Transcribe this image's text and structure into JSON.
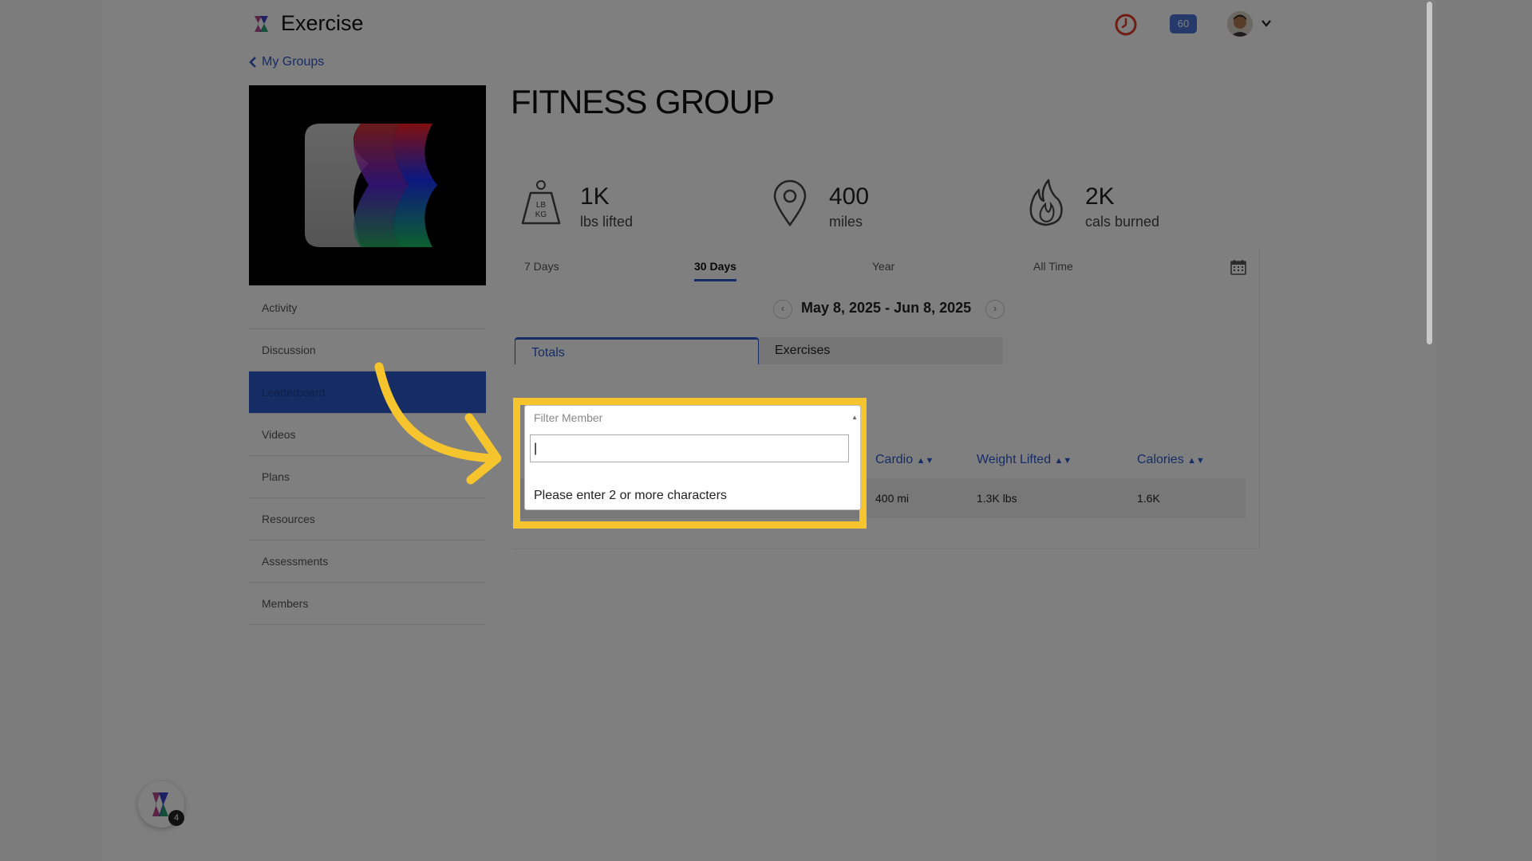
{
  "header": {
    "app_title": "Exercise",
    "badge": "60",
    "icons": [
      "logo-icon",
      "clock-icon",
      "avatar",
      "chevron-down-icon"
    ]
  },
  "back_link": "My Groups",
  "group": {
    "title": "FITNESS GROUP"
  },
  "sidebar": {
    "items": [
      {
        "label": "Activity"
      },
      {
        "label": "Discussion"
      },
      {
        "label": "Leaderboard",
        "active": true
      },
      {
        "label": "Videos"
      },
      {
        "label": "Plans"
      },
      {
        "label": "Resources"
      },
      {
        "label": "Assessments"
      },
      {
        "label": "Members"
      }
    ]
  },
  "stats": [
    {
      "value": "1K",
      "label": "lbs lifted",
      "icon": "weight-icon",
      "icon_text_top": "LB",
      "icon_text_bottom": "KG"
    },
    {
      "value": "400",
      "label": "miles",
      "icon": "map-pin-icon"
    },
    {
      "value": "2K",
      "label": "cals burned",
      "icon": "flame-icon"
    }
  ],
  "period_tabs": [
    {
      "label": "7 Days"
    },
    {
      "label": "30 Days",
      "active": true
    },
    {
      "label": "Year"
    },
    {
      "label": "All Time"
    }
  ],
  "date_range": "May 8, 2025 - Jun 8, 2025",
  "sub_tabs": [
    {
      "label": "Totals",
      "active": true
    },
    {
      "label": "Exercises"
    }
  ],
  "table": {
    "columns": [
      "Cardio",
      "Weight Lifted",
      "Calories"
    ],
    "rows": [
      {
        "cardio": "400 mi",
        "weight": "1.3K lbs",
        "calories": "1.6K"
      }
    ]
  },
  "filter": {
    "label": "Filter Member",
    "value": "|",
    "message": "Please enter 2 or more characters"
  },
  "fab": {
    "count": "4"
  },
  "colors": {
    "accent": "#2d58c9",
    "highlight": "#f6c52d",
    "badge": "#4c73d6"
  }
}
